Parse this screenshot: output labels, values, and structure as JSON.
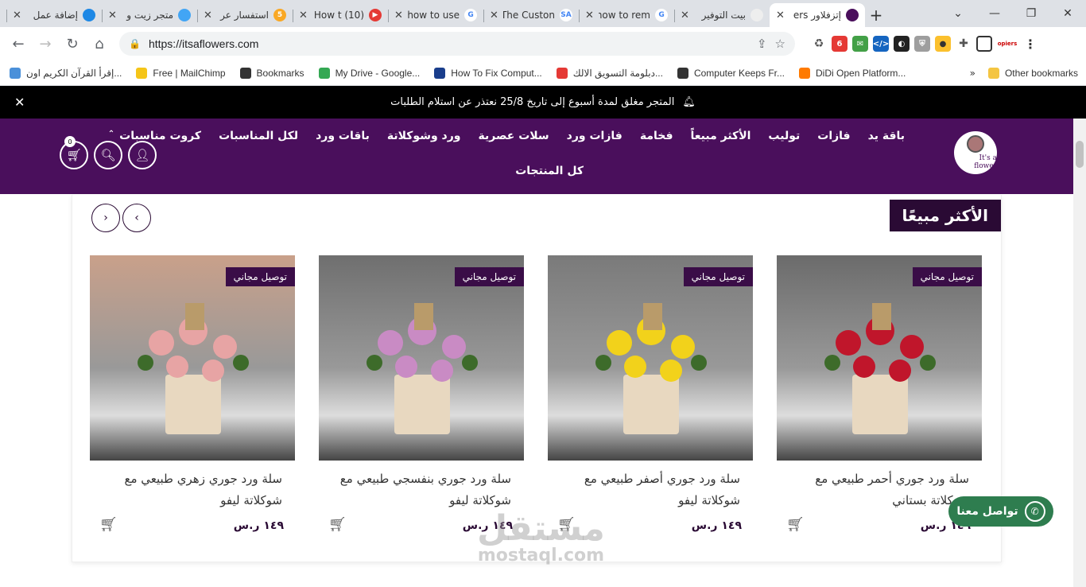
{
  "browser": {
    "tabs": [
      {
        "title": "إضافة عمل",
        "color": "#1e88e5",
        "glyph": ""
      },
      {
        "title": "متجر زيت و",
        "color": "#42a5f5",
        "glyph": ""
      },
      {
        "title": "استفسار عر",
        "color": "#f9a825",
        "glyph": "5"
      },
      {
        "title": "(10) How t",
        "color": "#e53935",
        "glyph": "▶"
      },
      {
        "title": "how to use",
        "color": "#ffffff",
        "glyph": "G"
      },
      {
        "title": "The Custon",
        "color": "#ffffff",
        "glyph": "SA"
      },
      {
        "title": "how to rem",
        "color": "#ffffff",
        "glyph": "G"
      },
      {
        "title": "بيت التوفير",
        "color": "#eeeeee",
        "glyph": ""
      },
      {
        "title": "إتزفلاور ers",
        "color": "#4a0f5c",
        "glyph": ""
      }
    ],
    "url": "https://itsaflowers.com",
    "bookmarks": [
      {
        "label": "إقرأ القرآن الكريم اون...",
        "color": "#4a90d9"
      },
      {
        "label": "Free | MailChimp",
        "color": "#f5c518"
      },
      {
        "label": "Bookmarks",
        "color": "#333333"
      },
      {
        "label": "My Drive - Google...",
        "color": "#34a853"
      },
      {
        "label": "How To Fix Comput...",
        "color": "#1a3e8c"
      },
      {
        "label": "دبلومة التسويق الالك...",
        "color": "#e53935"
      },
      {
        "label": "Computer Keeps Fr...",
        "color": "#333333"
      },
      {
        "label": "DiDi Open Platform...",
        "color": "#ff7a00"
      }
    ],
    "other_bookmarks": "Other bookmarks"
  },
  "site": {
    "notice": "المتجر مغلق لمدة أسبوع إلى تاريخ 25/8 نعتذر عن استلام الطلبات",
    "logo_text": "It's a flower",
    "menu": [
      "باقة يد",
      "فازات",
      "توليب",
      "الأكثر مبيعاً",
      "فخامة",
      "فازات ورد",
      "سلات عصرية",
      "ورد وشوكلاتة",
      "باقات ورد",
      "لكل المناسبات",
      "كروت مناسبات"
    ],
    "menu_second": "كل المنتجات",
    "cart_count": "0",
    "section_title": "الأكثر مبيعًا",
    "products": [
      {
        "badge": "توصيل مجاني",
        "name": "سلة ورد جوري أحمر طبيعي مع شوكلاتة بستاني",
        "price": "١٤٩ ر.س",
        "bg": "#6b6b6b",
        "flower": "#c0162b"
      },
      {
        "badge": "توصيل مجاني",
        "name": "سلة ورد جوري أصفر طبيعي مع شوكلاتة ليفو",
        "price": "١٤٩ ر.س",
        "bg": "#7a7a7a",
        "flower": "#f2d21b"
      },
      {
        "badge": "توصيل مجاني",
        "name": "سلة ورد جوري بنفسجي طبيعي مع شوكلاتة ليفو",
        "price": "١٤٩ ر.س",
        "bg": "#6f6f6f",
        "flower": "#c98bc4"
      },
      {
        "badge": "توصيل مجاني",
        "name": "سلة ورد جوري زهري طبيعي مع شوكلاتة ليفو",
        "price": "١٤٩ ر.س",
        "bg": "#c9a08a",
        "flower": "#e7a4a4"
      }
    ],
    "whatsapp_label": "تواصل معنا",
    "watermark": "مستقل",
    "watermark_sub": "mostaql.com"
  }
}
